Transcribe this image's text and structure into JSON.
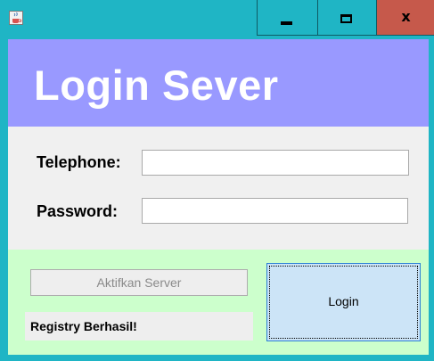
{
  "window": {
    "title": "",
    "icon": "java-cup-icon",
    "controls": {
      "minimize_icon": "minimize-icon",
      "maximize_icon": "maximize-icon",
      "close_label": "x"
    },
    "colors": {
      "titlebar": "#1fb5c5",
      "close": "#c6594b"
    }
  },
  "header": {
    "title": "Login Sever",
    "background": "#9999ff"
  },
  "form": {
    "telephone_label": "Telephone:",
    "telephone_value": "",
    "password_label": "Password:",
    "password_value": ""
  },
  "actions": {
    "aktifkan_label": "Aktifkan Server",
    "aktifkan_enabled": false,
    "login_label": "Login",
    "status_text": "Registry Berhasil!",
    "panel_background": "#ccffcc"
  }
}
